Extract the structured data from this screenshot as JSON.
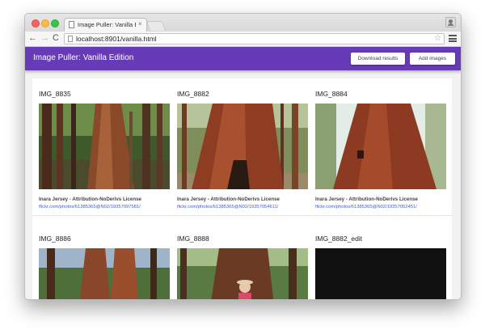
{
  "browser": {
    "tab_title": "Image Puller: Vanilla Edition",
    "tab_close": "×",
    "url": "localhost:8901/vanilla.html",
    "back_glyph": "←",
    "forward_glyph": "→",
    "reload_glyph": "C",
    "star_glyph": "☆"
  },
  "app": {
    "title": "Image Puller: Vanilla Edition",
    "download_label": "Download results",
    "add_label": "Add images"
  },
  "images": [
    {
      "title": "IMG_8835",
      "author": "Inara Jersey - Attribution-NoDerivs License",
      "link": "flickr.com/photos/61385365@N02/19357097581/"
    },
    {
      "title": "IMG_8882",
      "author": "Inara Jersey - Attribution-NoDerivs License",
      "link": "flickr.com/photos/61385365@N02/19357054611/"
    },
    {
      "title": "IMG_8884",
      "author": "Inara Jersey - Attribution-NoDerivs License",
      "link": "flickr.com/photos/61385365@N02/19357052451/"
    },
    {
      "title": "IMG_8886"
    },
    {
      "title": "IMG_8888"
    },
    {
      "title": "IMG_8882_edit"
    }
  ],
  "icons": [
    "close-icon",
    "back-arrow-icon",
    "forward-arrow-icon",
    "reload-icon",
    "page-icon",
    "star-icon",
    "menu-icon",
    "profile-icon"
  ],
  "colors": {
    "appbar": "#673ab7",
    "link": "#3b5bd6"
  }
}
